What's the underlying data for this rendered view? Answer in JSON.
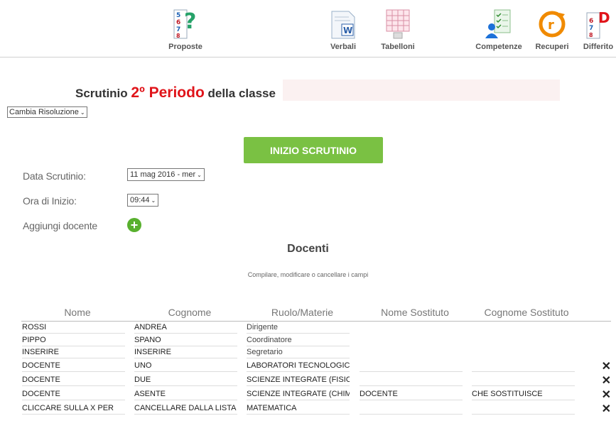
{
  "toolbar": {
    "items": [
      {
        "label": "Proposte",
        "icon": "numbers-question-icon"
      },
      {
        "label": "Verbali",
        "icon": "word-document-icon"
      },
      {
        "label": "Tabelloni",
        "icon": "spreadsheet-icon"
      },
      {
        "label": "Competenze",
        "icon": "checklist-user-icon"
      },
      {
        "label": "Recuperi",
        "icon": "recovery-r-icon"
      },
      {
        "label": "Differito",
        "icon": "numbers-d-icon"
      }
    ]
  },
  "title": {
    "prefix": "Scrutinio ",
    "period": "2º Periodo",
    "suffix": " della classe"
  },
  "resolution_select": "Cambia Risoluzione",
  "start_button": "INIZIO SCRUTINIO",
  "form": {
    "date_label": "Data Scrutinio:",
    "date_value": "11 mag 2016 - mer",
    "time_label": "Ora di Inizio:",
    "time_value": "09:44",
    "add_label": "Aggiungi docente"
  },
  "section": {
    "title": "Docenti",
    "subtitle": "Compilare, modificare o cancellare i campi"
  },
  "table": {
    "headers": [
      "Nome",
      "Cognome",
      "Ruolo/Materie",
      "Nome Sostituto",
      "Cognome Sostituto"
    ],
    "rows": [
      {
        "nome": "ROSSI",
        "cognome": "ANDREA",
        "ruolo": "Dirigente",
        "nome_sost": "",
        "cognome_sost": "",
        "deletable": false
      },
      {
        "nome": "PIPPO",
        "cognome": "SPANO",
        "ruolo": "Coordinatore",
        "nome_sost": "",
        "cognome_sost": "",
        "deletable": false
      },
      {
        "nome": "INSERIRE",
        "cognome": "INSERIRE",
        "ruolo": "Segretario",
        "nome_sost": "",
        "cognome_sost": "",
        "deletable": false
      },
      {
        "nome": "DOCENTE",
        "cognome": "UNO",
        "ruolo": "LABORATORI TECNOLOGIC",
        "nome_sost": "",
        "cognome_sost": "",
        "deletable": true
      },
      {
        "nome": "DOCENTE",
        "cognome": "DUE",
        "ruolo": "SCIENZE INTEGRATE (FISIC",
        "nome_sost": "",
        "cognome_sost": "",
        "deletable": true
      },
      {
        "nome": "DOCENTE",
        "cognome": "ASENTE",
        "ruolo": "SCIENZE INTEGRATE (CHIM",
        "nome_sost": "DOCENTE",
        "cognome_sost": "CHE SOSTITUISCE",
        "deletable": true
      },
      {
        "nome": "CLICCARE SULLA X PER",
        "cognome": "CANCELLARE DALLA LISTA",
        "ruolo": "MATEMATICA",
        "nome_sost": "",
        "cognome_sost": "",
        "deletable": true
      }
    ],
    "delete_glyph": "✕"
  },
  "colors": {
    "accent_red": "#e0141a",
    "button_green": "#7ac143",
    "add_green": "#58b02e",
    "title_field_bg": "#fbf1f1"
  }
}
